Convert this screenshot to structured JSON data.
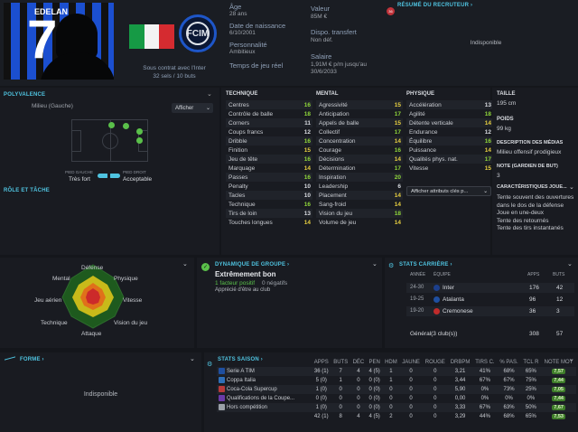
{
  "header": {
    "player_name": "EDELAN",
    "shirt_number": "7",
    "contract_text": "Sous contrat avec l'Inter",
    "apps_goals": "32 sels / 10 buts",
    "age_label": "Âge",
    "age_value": "28 ans",
    "dob_label": "Date de naissance",
    "dob_value": "6/10/2001",
    "personality_label": "Personnalité",
    "personality_value": "Ambitieux",
    "playing_time_label": "Temps de jeu réel",
    "value_label": "Valeur",
    "value_value": "85M €",
    "transfer_label": "Dispo. transfert",
    "transfer_value": "Non déf.",
    "salary_label": "Salaire",
    "salary_value": "1,91M € p/m jusqu'au 30/6/2033",
    "scout_title": "RÉSUMÉ DU RECRUTEUR",
    "scout_badge": "36",
    "scout_value": "Indisponible"
  },
  "positions": {
    "title": "POLYVALENCE",
    "position_text": "Milieu (Gauche)",
    "show_button": "Afficher",
    "left_foot_label": "PIED GAUCHE",
    "left_foot_value": "Très fort",
    "right_foot_label": "PIED DROIT",
    "right_foot_value": "Acceptable",
    "roles_title": "RÔLE ET TÂCHE"
  },
  "technique": {
    "title": "TECHNIQUE",
    "rows": [
      {
        "n": "Centres",
        "v": "16",
        "c": "g"
      },
      {
        "n": "Contrôle de balle",
        "v": "18",
        "c": "g"
      },
      {
        "n": "Corners",
        "v": "11",
        "c": "w"
      },
      {
        "n": "Coups francs",
        "v": "12",
        "c": "w"
      },
      {
        "n": "Dribble",
        "v": "16",
        "c": "g"
      },
      {
        "n": "Finition",
        "v": "15",
        "c": "y"
      },
      {
        "n": "Jeu de tête",
        "v": "16",
        "c": "g"
      },
      {
        "n": "Marquage",
        "v": "14",
        "c": "y"
      },
      {
        "n": "Passes",
        "v": "16",
        "c": "g"
      },
      {
        "n": "Penalty",
        "v": "10",
        "c": "w"
      },
      {
        "n": "Tacles",
        "v": "10",
        "c": "w"
      },
      {
        "n": "Technique",
        "v": "16",
        "c": "g"
      },
      {
        "n": "Tirs de loin",
        "v": "13",
        "c": "w"
      },
      {
        "n": "Touches longues",
        "v": "14",
        "c": "y"
      }
    ]
  },
  "mental": {
    "title": "MENTAL",
    "rows": [
      {
        "n": "Agressivité",
        "v": "15",
        "c": "y"
      },
      {
        "n": "Anticipation",
        "v": "17",
        "c": "g"
      },
      {
        "n": "Appels de balle",
        "v": "15",
        "c": "y"
      },
      {
        "n": "Collectif",
        "v": "17",
        "c": "g"
      },
      {
        "n": "Concentration",
        "v": "14",
        "c": "y"
      },
      {
        "n": "Courage",
        "v": "16",
        "c": "g"
      },
      {
        "n": "Décisions",
        "v": "14",
        "c": "y"
      },
      {
        "n": "Détermination",
        "v": "17",
        "c": "g"
      },
      {
        "n": "Inspiration",
        "v": "20",
        "c": "g"
      },
      {
        "n": "Leadership",
        "v": "6",
        "c": "w"
      },
      {
        "n": "Placement",
        "v": "14",
        "c": "y"
      },
      {
        "n": "Sang-froid",
        "v": "14",
        "c": "y"
      },
      {
        "n": "Vision du jeu",
        "v": "18",
        "c": "g"
      },
      {
        "n": "Volume de jeu",
        "v": "14",
        "c": "y"
      }
    ]
  },
  "physique": {
    "title": "PHYSIQUE",
    "rows": [
      {
        "n": "Accélération",
        "v": "13",
        "c": "w"
      },
      {
        "n": "Agilité",
        "v": "18",
        "c": "g"
      },
      {
        "n": "Détente verticale",
        "v": "14",
        "c": "y"
      },
      {
        "n": "Endurance",
        "v": "12",
        "c": "w"
      },
      {
        "n": "Équilibre",
        "v": "16",
        "c": "g"
      },
      {
        "n": "Puissance",
        "v": "14",
        "c": "y"
      },
      {
        "n": "Qualités phys. nat.",
        "v": "17",
        "c": "g"
      },
      {
        "n": "Vitesse",
        "v": "15",
        "c": "y"
      }
    ],
    "show_attr_button": "Afficher attributs clés p..."
  },
  "side": {
    "height_label": "TAILLE",
    "height_value": "195 cm",
    "weight_label": "POIDS",
    "weight_value": "99 kg",
    "media_label": "DESCRIPTION DES MÉDIAS",
    "media_value": "Milieu offensif prodigieux",
    "gk_label": "NOTE (GARDIEN DE BUT)",
    "gk_value": "3",
    "traits_label": "CARACTÉRISTIQUES JOUE...",
    "traits": [
      "Tente souvent des ouvertures dans le dos de la défense",
      "Joue en une-deux",
      "Tente des retournés",
      "Tente des tirs instantanés"
    ]
  },
  "radar": {
    "labels": [
      "Défense",
      "Physique",
      "Vitesse",
      "Vision du jeu",
      "Attaque",
      "Technique",
      "Jeu aérien",
      "Mental"
    ]
  },
  "dynamics": {
    "title": "DYNAMIQUE DE GROUPE",
    "value": "Extrêmement bon",
    "positive": "1 facteur positif",
    "negative": "0 négatifs",
    "note": "Apprécié d'être au club"
  },
  "career": {
    "title": "STATS CARRIÈRE",
    "h_year": "ANNÉE",
    "h_team": "ÉQUIPE",
    "h_apps": "APPS",
    "h_goals": "BUTS",
    "rows": [
      {
        "y": "24-30",
        "t": "Inter",
        "a": "176",
        "g": "42",
        "c": "#1c3f8c"
      },
      {
        "y": "19-25",
        "t": "Atalanta",
        "a": "96",
        "g": "12",
        "c": "#1f4fa0"
      },
      {
        "y": "19-20",
        "t": "Cremonese",
        "a": "36",
        "g": "3",
        "c": "#c02b2b"
      }
    ],
    "total_label": "Général(3 club(s))",
    "total_apps": "308",
    "total_goals": "57"
  },
  "form": {
    "title": "FORME",
    "value": "Indisponible"
  },
  "season": {
    "title": "STATS SAISON",
    "headers": [
      "APPS",
      "BUTS",
      "DÉC",
      "PEN",
      "HDM",
      "JAUNE",
      "ROUGE",
      "DRBPM",
      "TIRS C.",
      "% PAS.",
      "TCL R",
      "NOTE MOY"
    ],
    "rows": [
      {
        "comp": "Serie A TIM",
        "c": "#1f4fa0",
        "vals": [
          "36 (1)",
          "7",
          "4",
          "4 (5)",
          "1",
          "0",
          "0",
          "3,21",
          "41%",
          "68%",
          "65%"
        ],
        "note": "7,57"
      },
      {
        "comp": "Coppa Italia",
        "c": "#2f6fb8",
        "vals": [
          "5 (0)",
          "1",
          "0",
          "0 (0)",
          "1",
          "0",
          "0",
          "3,44",
          "67%",
          "67%",
          "75%"
        ],
        "note": "7,44"
      },
      {
        "comp": "Coca-Cola Supercup",
        "c": "#b83a3a",
        "vals": [
          "1 (0)",
          "0",
          "0",
          "0 (0)",
          "0",
          "0",
          "0",
          "5,90",
          "0%",
          "73%",
          "25%"
        ],
        "note": "7,05"
      },
      {
        "comp": "Qualifications de la Coupe...",
        "c": "#6a3aa8",
        "vals": [
          "0 (0)",
          "0",
          "0",
          "0 (0)",
          "0",
          "0",
          "0",
          "0,00",
          "0%",
          "0%",
          "0%"
        ],
        "note": "7,44"
      },
      {
        "comp": "Hors compétition",
        "c": "#9aa0a8",
        "vals": [
          "1 (0)",
          "0",
          "0",
          "0 (0)",
          "0",
          "0",
          "0",
          "3,33",
          "67%",
          "63%",
          "50%"
        ],
        "note": "7,67"
      },
      {
        "comp": "",
        "c": "",
        "vals": [
          "42 (1)",
          "8",
          "4",
          "4 (5)",
          "2",
          "0",
          "0",
          "3,29",
          "44%",
          "68%",
          "65%"
        ],
        "note": "7,53"
      }
    ]
  }
}
